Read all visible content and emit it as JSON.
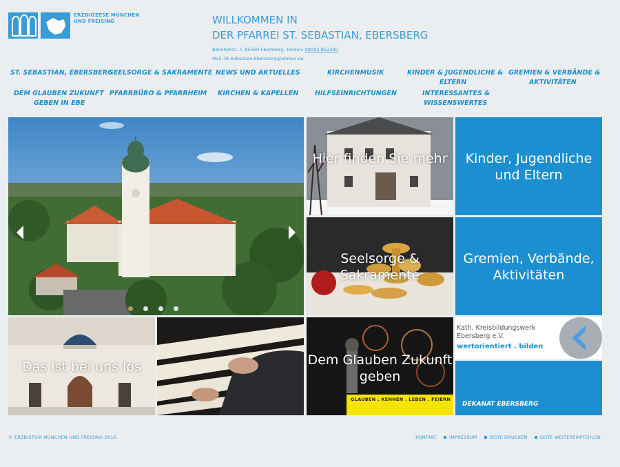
{
  "logo": {
    "line1": "ERZDIÖZESE MÜNCHEN",
    "line2": "UND FREISING"
  },
  "header": {
    "title_line1": "WILLKOMMEN IN",
    "title_line2": "DER PFARREI ST. SEBASTIAN, EBERSBERG",
    "address": "Bahnhofstr. 7, 85560 Ebersberg, Telefon:",
    "phone": "08092-853390",
    "mail": "Mail: St-Sebastian.Ebersberg@ebmuc.de"
  },
  "nav": {
    "row1": [
      "ST. SEBASTIAN, EBERSBERG",
      "SEELSORGE & SAKRAMENTE",
      "NEWS UND AKTUELLES",
      "KIRCHENMUSIK",
      "KINDER & JUGENDLICHE &",
      "GREMIEN & VERBÄNDE &"
    ],
    "row1b": [
      "ELTERN",
      "AKTIVITÄTEN"
    ],
    "row2": [
      "DEM GLAUBEN ZUKUNFT",
      "PFARRBÜRO & PFARRHEIM",
      "KIRCHEN & KAPELLEN",
      "HILFSEINRICHTUNGEN",
      "INTERESSANTES &"
    ],
    "row2b": [
      "GEBEN IN EBE",
      "WISSENSWERTES"
    ]
  },
  "tiles": {
    "hier": "Hier finden Sie mehr",
    "kinder": "Kinder, Jugendliche und Eltern",
    "seelsorge": "Seelsorge & Sakramente",
    "gremien": "Gremien, Verbände, Aktivitäten",
    "los": "Das ist bei uns los",
    "glauben": "Dem Glauben Zukunft geben",
    "glauben_banner": "GLAUBEN . KENNEN . LEBEN . FEIERN",
    "kbw_line1": "Kath. Kreisbildungswerk",
    "kbw_line2": "Ebersberg e.V.",
    "kbw_line3": "wertorientiert . bilden",
    "dekanat": "DEKANAT EBERSBERG"
  },
  "footer": {
    "copyright": "© ERZBISTUM MÜNCHEN UND FREISING 2016",
    "links": [
      "KONTAKT",
      "IMPRESSUM",
      "SEITE DRUCKEN",
      "SEITE WEITEREMPFEHLEN"
    ]
  },
  "colors": {
    "accent": "#3a9bd5",
    "tile_blue": "#1c8fd0"
  }
}
